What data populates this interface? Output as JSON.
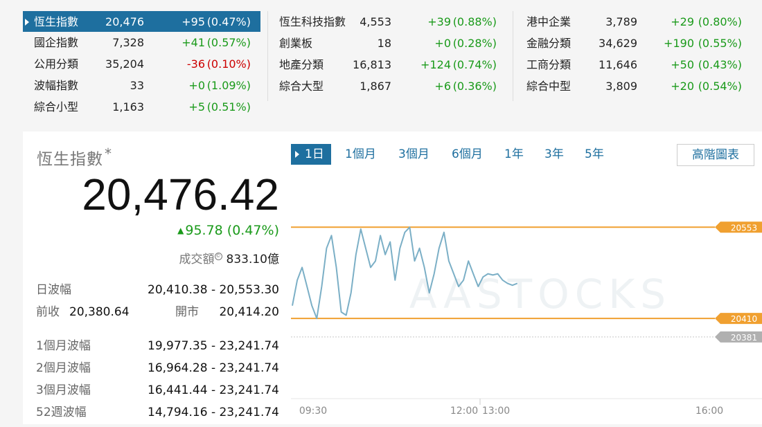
{
  "indices": {
    "col1": [
      {
        "name": "恆生指數",
        "value": "20,476",
        "change": "+95",
        "pct": "(0.47%)",
        "dir": "up",
        "active": true
      },
      {
        "name": "國企指數",
        "value": "7,328",
        "change": "+41",
        "pct": "(0.57%)",
        "dir": "up"
      },
      {
        "name": "公用分類",
        "value": "35,204",
        "change": "-36",
        "pct": "(0.10%)",
        "dir": "down"
      },
      {
        "name": "波幅指數",
        "value": "33",
        "change": "+0",
        "pct": "(1.09%)",
        "dir": "up"
      },
      {
        "name": "綜合小型",
        "value": "1,163",
        "change": "+5",
        "pct": "(0.51%)",
        "dir": "up"
      }
    ],
    "col2": [
      {
        "name": "恆生科技指數",
        "value": "4,553",
        "change": "+39",
        "pct": "(0.88%)",
        "dir": "up"
      },
      {
        "name": "創業板",
        "value": "18",
        "change": "+0",
        "pct": "(0.28%)",
        "dir": "up"
      },
      {
        "name": "地產分類",
        "value": "16,813",
        "change": "+124",
        "pct": "(0.74%)",
        "dir": "up"
      },
      {
        "name": "綜合大型",
        "value": "1,867",
        "change": "+6",
        "pct": "(0.36%)",
        "dir": "up"
      }
    ],
    "col3": [
      {
        "name": "港中企業",
        "value": "3,789",
        "change": "+29",
        "pct": "(0.80%)",
        "dir": "up"
      },
      {
        "name": "金融分類",
        "value": "34,629",
        "change": "+190",
        "pct": "(0.55%)",
        "dir": "up"
      },
      {
        "name": "工商分類",
        "value": "11,646",
        "change": "+50",
        "pct": "(0.43%)",
        "dir": "up"
      },
      {
        "name": "綜合中型",
        "value": "3,809",
        "change": "+20",
        "pct": "(0.54%)",
        "dir": "up"
      }
    ]
  },
  "quote": {
    "title": "恆生指數",
    "title_mark": "*",
    "price": "20,476.42",
    "change": "95.78 (0.47%)",
    "turnover_label": "成交額",
    "turnover_info": "©",
    "turnover_value": "833.10億",
    "day_range_label": "日波幅",
    "day_range_value": "20,410.38 - 20,553.30",
    "prev_close_label": "前收",
    "prev_close_value": "20,380.64",
    "open_label": "開市",
    "open_value": "20,414.20",
    "ranges": [
      {
        "label": "1個月波幅",
        "value": "19,977.35 - 23,241.74"
      },
      {
        "label": "2個月波幅",
        "value": "16,964.28 - 23,241.74"
      },
      {
        "label": "3個月波幅",
        "value": "16,441.44 - 23,241.74"
      },
      {
        "label": "52週波幅",
        "value": "14,794.16 - 23,241.74"
      }
    ]
  },
  "tabs": [
    "1日",
    "1個月",
    "3個月",
    "6個月",
    "1年",
    "3年",
    "5年"
  ],
  "advanced_chart_label": "高階圖表",
  "chart_data": {
    "type": "line",
    "watermark": "AASTOCKS",
    "x_ticks": [
      "09:30",
      "12:00",
      "13:00",
      "16:00"
    ],
    "reference_lines": [
      {
        "label": "20553",
        "value": 20553,
        "color": "#f0a030"
      },
      {
        "label": "20410",
        "value": 20410,
        "color": "#f0a030"
      },
      {
        "label": "20381",
        "value": 20381,
        "color": "#b0b0b0"
      }
    ],
    "ylim": [
      20370,
      20575
    ],
    "series": [
      {
        "values": [
          20430,
          20470,
          20490,
          20460,
          20430,
          20410,
          20460,
          20520,
          20540,
          20490,
          20420,
          20415,
          20450,
          20510,
          20550,
          20520,
          20490,
          20500,
          20540,
          20510,
          20530,
          20470,
          20520,
          20545,
          20553,
          20500,
          20520,
          20490,
          20450,
          20480,
          20520,
          20545,
          20500,
          20480,
          20460,
          20470,
          20500,
          20480,
          20460,
          20475,
          20480,
          20478,
          20480,
          20470,
          20465,
          20462,
          20465
        ]
      }
    ],
    "line_color": "#7bafc6",
    "grid": false
  }
}
